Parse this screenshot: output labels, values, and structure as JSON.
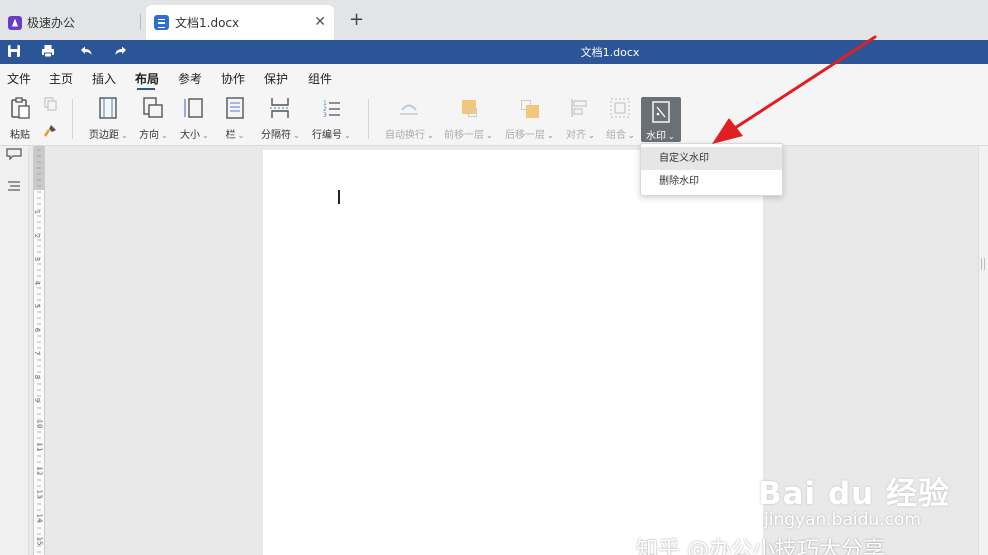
{
  "tabs": {
    "app_label": "极速办公",
    "doc_label": "文档1.docx",
    "close_icon": "close-icon",
    "add_icon": "plus-icon"
  },
  "titlebar": {
    "title": "文档1.docx",
    "accent": "#2c5597"
  },
  "menu": {
    "items": [
      "文件",
      "主页",
      "插入",
      "布局",
      "参考",
      "协作",
      "保护",
      "组件"
    ],
    "active": "布局"
  },
  "ribbon": {
    "paste": "粘贴",
    "margins": "页边距",
    "orientation": "方向",
    "size": "大小",
    "columns": "栏",
    "breaks": "分隔符",
    "line_numbers": "行编号",
    "wrap": "自动换行",
    "bring_forward": "前移一层",
    "send_backward": "后移一层",
    "align": "对齐",
    "group": "组合",
    "watermark": "水印"
  },
  "dropdown": {
    "items": [
      "自定义水印",
      "删除水印"
    ]
  },
  "ruler": {
    "numbers": [
      "1",
      "2",
      "3",
      "4",
      "5",
      "6",
      "7",
      "8",
      "9",
      "10",
      "11",
      "12",
      "13",
      "14",
      "15",
      "16"
    ]
  },
  "overlay": {
    "baidu": "Bai du 经验",
    "baidu_sub": "jingyan.baidu.com",
    "zhihu": "知乎 @办公小技巧大分享",
    "arrow_color": "#e02020"
  }
}
